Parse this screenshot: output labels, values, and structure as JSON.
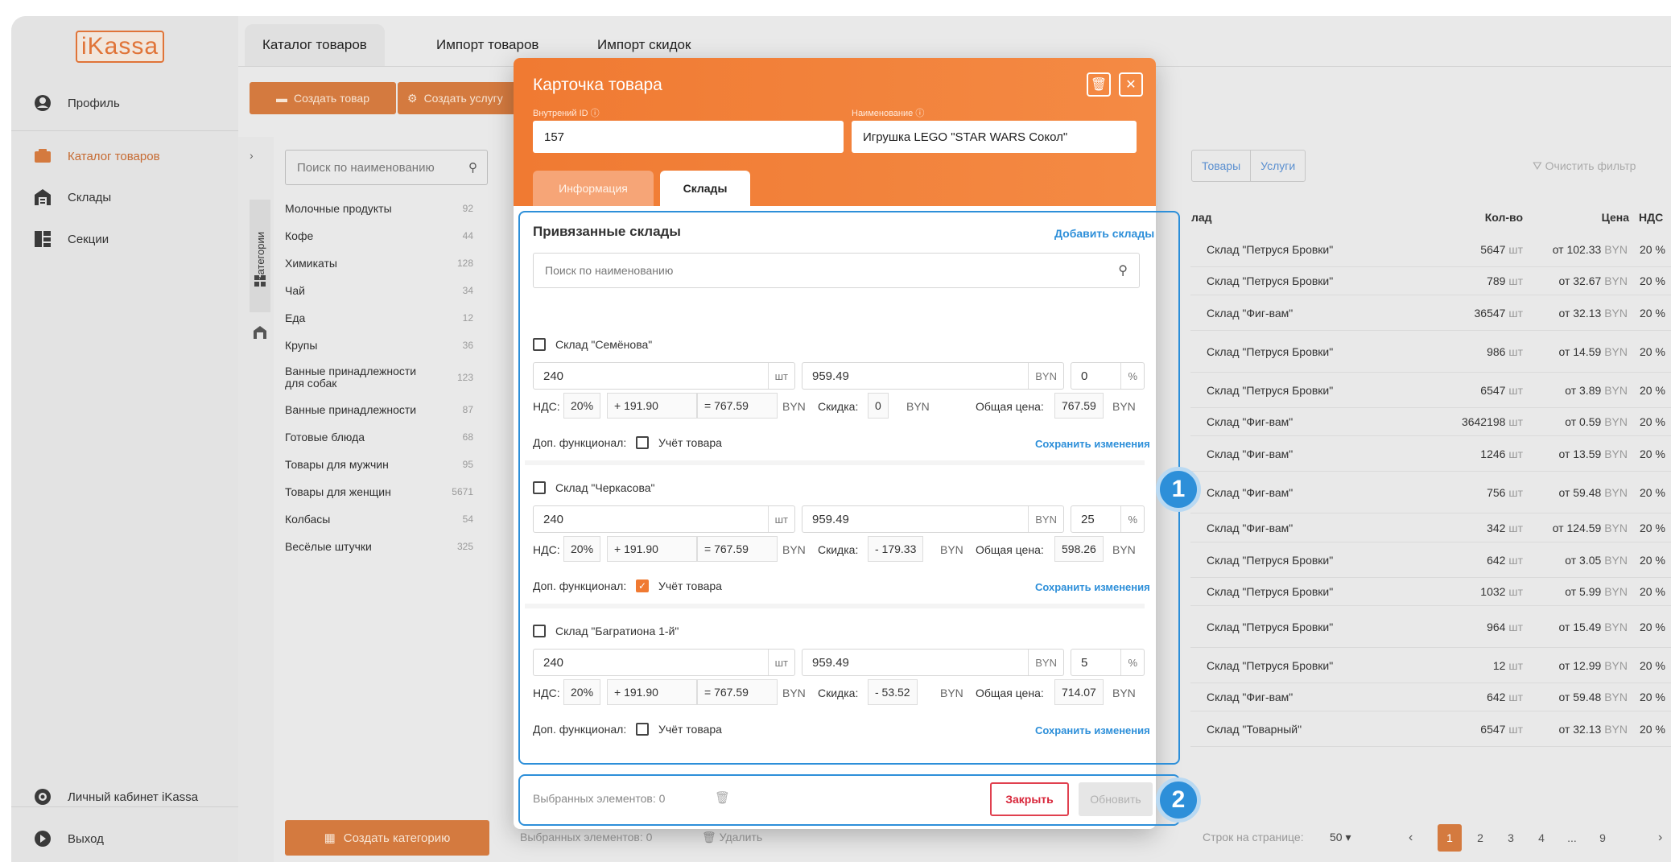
{
  "app": {
    "logo": "iKassa"
  },
  "sidebar": {
    "items": [
      {
        "label": "Профиль",
        "icon": "user-icon"
      },
      {
        "label": "Каталог товаров",
        "icon": "catalog-icon"
      },
      {
        "label": "Склады",
        "icon": "warehouse-icon"
      },
      {
        "label": "Секции",
        "icon": "sections-icon"
      }
    ],
    "bottom": [
      {
        "label": "Личный кабинет iKassa",
        "icon": "cabinet-icon"
      },
      {
        "label": "Выход",
        "icon": "logout-icon"
      }
    ]
  },
  "tabs": [
    "Каталог товаров",
    "Импорт товаров",
    "Импорт скидок"
  ],
  "toolbar": {
    "create_product": "Создать товар",
    "create_service": "Создать услугу"
  },
  "categories": {
    "search_placeholder": "Поиск по наименованию",
    "vertical_label": "Категории",
    "items": [
      {
        "name": "Молочные продукты",
        "count": "92"
      },
      {
        "name": "Кофе",
        "count": "44"
      },
      {
        "name": "Химикаты",
        "count": "128"
      },
      {
        "name": "Чай",
        "count": "34"
      },
      {
        "name": "Еда",
        "count": "12"
      },
      {
        "name": "Крупы",
        "count": "36"
      },
      {
        "name": "Ванные принадлежности для собак",
        "count": "123"
      },
      {
        "name": "Ванные принадлежности",
        "count": "87"
      },
      {
        "name": "Готовые блюда",
        "count": "68"
      },
      {
        "name": "Товары для мужчин",
        "count": "95"
      },
      {
        "name": "Товары для женщин",
        "count": "5671"
      },
      {
        "name": "Колбасы",
        "count": "54"
      },
      {
        "name": "Весёлые штучки",
        "count": "325"
      }
    ],
    "create_button": "Создать категорию"
  },
  "table": {
    "filter_tabs": [
      "Товары",
      "Услуги"
    ],
    "clear_filter": "Очистить фильтр",
    "headers": {
      "warehouse": "лад",
      "qty": "Кол-во",
      "price": "Цена",
      "vat": "НДС"
    },
    "rows": [
      {
        "warehouse": "Склад \"Петруся Бровки\"",
        "qty": "5647",
        "price": "от 102.33",
        "vat": "20 %"
      },
      {
        "warehouse": "Склад \"Петруся Бровки\"",
        "qty": "789",
        "price": "от 32.67",
        "vat": "20 %"
      },
      {
        "warehouse": "Склад \"Фиг-вам\"",
        "qty": "36547",
        "price": "от 32.13",
        "vat": "20 %"
      },
      {
        "warehouse": "Склад \"Петруся Бровки\"",
        "qty": "986",
        "price": "от 14.59",
        "vat": "20 %"
      },
      {
        "warehouse": "Склад \"Петруся Бровки\"",
        "qty": "6547",
        "price": "от 3.89",
        "vat": "20 %"
      },
      {
        "warehouse": "Склад \"Фиг-вам\"",
        "qty": "3642198",
        "price": "от 0.59",
        "vat": "20 %"
      },
      {
        "warehouse": "Склад \"Фиг-вам\"",
        "qty": "1246",
        "price": "от 13.59",
        "vat": "20 %"
      },
      {
        "warehouse": "Склад \"Фиг-вам\"",
        "qty": "756",
        "price": "от 59.48",
        "vat": "20 %"
      },
      {
        "warehouse": "Склад \"Фиг-вам\"",
        "qty": "342",
        "price": "от 124.59",
        "vat": "20 %"
      },
      {
        "warehouse": "Склад \"Петруся Бровки\"",
        "qty": "642",
        "price": "от 3.05",
        "vat": "20 %"
      },
      {
        "warehouse": "Склад \"Петруся Бровки\"",
        "qty": "1032",
        "price": "от 5.99",
        "vat": "20 %"
      },
      {
        "warehouse": "Склад \"Петруся Бровки\"",
        "qty": "964",
        "price": "от 15.49",
        "vat": "20 %"
      },
      {
        "warehouse": "Склад \"Петруся Бровки\"",
        "qty": "12",
        "price": "от 12.99",
        "vat": "20 %"
      },
      {
        "warehouse": "Склад \"Фиг-вам\"",
        "qty": "642",
        "price": "от 59.48",
        "vat": "20 %"
      },
      {
        "warehouse": "Склад \"Товарный\"",
        "qty": "6547",
        "price": "от 32.13",
        "vat": "20 %"
      }
    ],
    "qty_unit": "шт",
    "currency": "BYN",
    "footer": {
      "selected": "Выбранных элементов: 0",
      "delete": "Удалить",
      "rows_per_page": "Строк на странице:",
      "rows_value": "50",
      "pages": [
        "1",
        "2",
        "3",
        "4",
        "...",
        "9"
      ]
    }
  },
  "modal": {
    "title": "Карточка товара",
    "id_label": "Внутрений ID",
    "id_value": "157",
    "name_label": "Наименование",
    "name_value": "Игрушка LEGO \"STAR WARS Сокол\"",
    "tabs": [
      "Информация",
      "Склады"
    ],
    "linked_title": "Привязанные склады",
    "add_link": "Добавить склады",
    "search_placeholder": "Поиск по наименованию",
    "vat_label": "НДС:",
    "discount_label": "Скидка:",
    "total_label": "Общая цена:",
    "extra_label": "Доп. функционал:",
    "track_label": "Учёт товара",
    "save_link": "Сохранить изменения",
    "unit_qty": "шт",
    "unit_cur": "BYN",
    "unit_pct": "%",
    "warehouses": [
      {
        "name": "Склад \"Семёнова\"",
        "qty": "240",
        "price": "959.49",
        "pct": "0",
        "vat": "20%",
        "vat_add": "+ 191.90",
        "net": "= 767.59",
        "discount": "0",
        "total": "767.59",
        "track": false
      },
      {
        "name": "Склад \"Черкасова\"",
        "qty": "240",
        "price": "959.49",
        "pct": "25",
        "vat": "20%",
        "vat_add": "+ 191.90",
        "net": "= 767.59",
        "discount": "- 179.33",
        "total": "598.26",
        "track": true
      },
      {
        "name": "Склад \"Багратиона 1-й\"",
        "qty": "240",
        "price": "959.49",
        "pct": "5",
        "vat": "20%",
        "vat_add": "+ 191.90",
        "net": "= 767.59",
        "discount": "- 53.52",
        "total": "714.07",
        "track": false
      }
    ],
    "footer": {
      "selected": "Выбранных элементов: 0",
      "close": "Закрыть",
      "update": "Обновить"
    }
  },
  "callouts": [
    "1",
    "2"
  ]
}
